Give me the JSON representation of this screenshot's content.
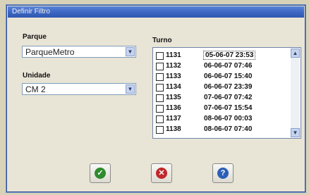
{
  "window": {
    "title": "Definir Filtro"
  },
  "parque": {
    "label": "Parque",
    "value": "ParqueMetro"
  },
  "unidade": {
    "label": "Unidade",
    "value": "CM 2"
  },
  "turno": {
    "label": "Turno",
    "rows": [
      {
        "num": "1131",
        "datetime": "05-06-07 23:53"
      },
      {
        "num": "1132",
        "datetime": "06-06-07 07:46"
      },
      {
        "num": "1133",
        "datetime": "06-06-07 15:40"
      },
      {
        "num": "1134",
        "datetime": "06-06-07 23:39"
      },
      {
        "num": "1135",
        "datetime": "07-06-07 07:42"
      },
      {
        "num": "1136",
        "datetime": "07-06-07 15:54"
      },
      {
        "num": "1137",
        "datetime": "08-06-07 00:03"
      },
      {
        "num": "1138",
        "datetime": "08-06-07 07:40"
      }
    ]
  },
  "icons": {
    "ok": "check-circle-icon",
    "cancel": "cross-circle-icon",
    "help": "question-circle-icon"
  },
  "colors": {
    "ok": "#2e8b2e",
    "cancel": "#c0282a",
    "help": "#2c5fb8"
  }
}
